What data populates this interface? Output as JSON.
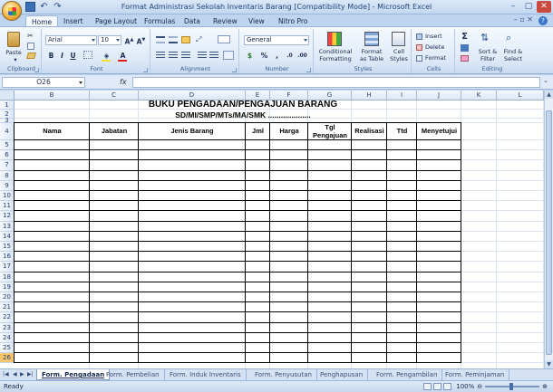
{
  "window": {
    "title": "Format Administrasi Sekolah Inventaris Barang  [Compatibility Mode] - Microsoft Excel",
    "controls": [
      "–",
      "▢",
      "✕"
    ]
  },
  "ribbon_tabs": [
    "Home",
    "Insert",
    "Page Layout",
    "Formulas",
    "Data",
    "Review",
    "View",
    "Nitro Pro"
  ],
  "ribbon": {
    "clipboard": {
      "label": "Clipboard",
      "paste": "Paste"
    },
    "font": {
      "label": "Font",
      "name": "Arial",
      "size": "10"
    },
    "alignment": {
      "label": "Alignment"
    },
    "number": {
      "label": "Number",
      "format": "General"
    },
    "styles": {
      "label": "Styles",
      "cond": "Conditional\nFormatting",
      "table": "Format\nas Table",
      "cell": "Cell\nStyles"
    },
    "cells": {
      "label": "Cells",
      "insert": "Insert",
      "delete": "Delete",
      "format": "Format"
    },
    "editing": {
      "label": "Editing",
      "sort": "Sort &\nFilter",
      "find": "Find &\nSelect"
    }
  },
  "formula_bar": {
    "name_box": "O26",
    "fx": "fx",
    "value": ""
  },
  "columns": [
    "B",
    "C",
    "D",
    "E",
    "F",
    "G",
    "H",
    "I",
    "J",
    "K",
    "L"
  ],
  "rows": [
    "1",
    "2",
    "3",
    "4",
    "5",
    "6",
    "7",
    "8",
    "9",
    "10",
    "11",
    "12",
    "13",
    "14",
    "15",
    "16",
    "17",
    "18",
    "19",
    "20",
    "21",
    "22",
    "23",
    "24",
    "25",
    "26"
  ],
  "sheet": {
    "title1": "BUKU PENGADAAN/PENGAJUAN BARANG",
    "title2": "SD/MI/SMP/MTs/MA/SMK ....................",
    "headers": [
      "Nama",
      "Jabatan",
      "Jenis Barang",
      "Jml",
      "Harga",
      "Tgl\nPengajuan",
      "Realisasi",
      "Ttd",
      "Menyetujui"
    ]
  },
  "sheet_tabs": [
    "Form. Pengadaan",
    "Form. Pembelian",
    "Form. Induk Inventaris",
    "Form. Penyusutan",
    "Penghapusan",
    "Form. Pengambilan",
    "Form. Peminjaman"
  ],
  "status": {
    "ready": "Ready",
    "zoom": "100%"
  }
}
